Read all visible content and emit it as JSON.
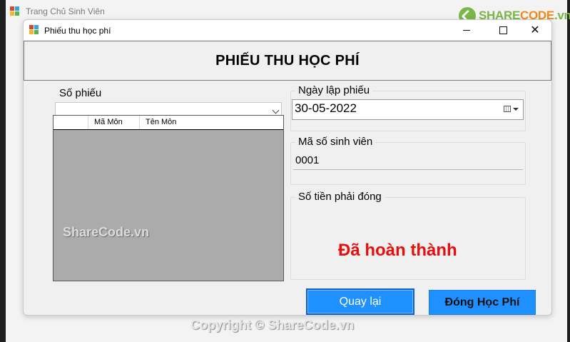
{
  "parent_window": {
    "title": "Trang Chủ Sinh Viên"
  },
  "logo": {
    "part1": "SHARE",
    "part2": "CODE",
    "part3": ".vn"
  },
  "dialog": {
    "title": "Phiếu thu học phí",
    "header": "PHIẾU THU HỌC PHÍ",
    "receipt_number": {
      "label": "Số phiếu",
      "value": ""
    },
    "created_date": {
      "label": "Ngày lập phiếu",
      "value": "30-05-2022"
    },
    "student_id": {
      "label": "Mã số sinh viên",
      "value": "0001"
    },
    "amount_due": {
      "label": "Số tiền phải đóng",
      "status_text": "Đã hoàn thành",
      "status_color": "#e80e0e"
    },
    "grid": {
      "columns": [
        "",
        "Mã Môn",
        "Tên Môn"
      ],
      "rows": [],
      "watermark": "ShareCode.vn"
    },
    "buttons": {
      "back": "Quay lại",
      "pay": "Đóng Học Phí"
    }
  },
  "watermark_footer": "Copyright © ShareCode.vn",
  "colors": {
    "button_blue": "#1e90ff",
    "logo_green": "#7ab648",
    "logo_orange": "#f08a1c"
  }
}
